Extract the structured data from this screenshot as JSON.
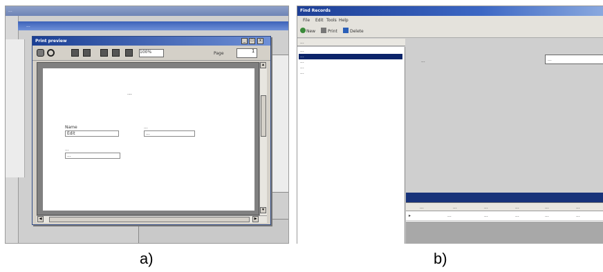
{
  "panel_a": {
    "outer_title": "...",
    "bg_window_title": "...",
    "preview": {
      "title": "Print preview",
      "win_min": "_",
      "win_max": "□",
      "win_close": "x",
      "zoom": "100%",
      "page_label": "Page",
      "page_value": "1",
      "document": {
        "heading": "...",
        "field1_label": "Name",
        "field1_value": "Edit",
        "field2_label": "...",
        "field2_value": "...",
        "field3_label": "...",
        "field3_value": "..."
      }
    }
  },
  "panel_b": {
    "title": "Find Records",
    "menu": [
      "File",
      "Edit",
      "Tools",
      "Help"
    ],
    "toolbar": {
      "new": "New",
      "print": "Print",
      "delete": "Delete"
    },
    "tabstrip": "...",
    "list": [
      "...",
      "...",
      "...",
      "...",
      "..."
    ],
    "selected_index": 1,
    "field_label": "...",
    "field_value": "...",
    "grid_columns": [
      "...",
      "...",
      "...",
      "...",
      "...",
      "..."
    ],
    "grid_row": [
      "...",
      "...",
      "...",
      "...",
      "..."
    ]
  },
  "captions": {
    "a": "a)",
    "b": "b)"
  }
}
